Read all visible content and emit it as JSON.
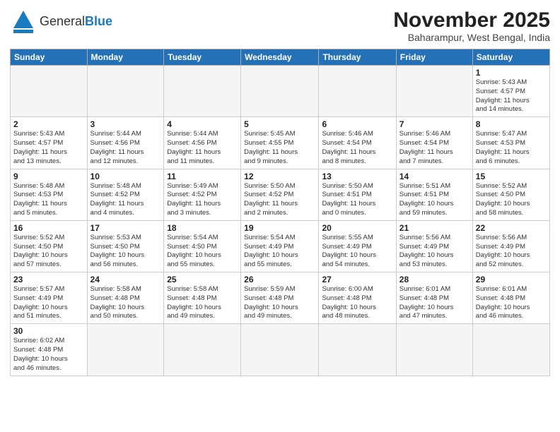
{
  "header": {
    "logo_general": "General",
    "logo_blue": "Blue",
    "month_title": "November 2025",
    "location": "Baharampur, West Bengal, India"
  },
  "weekdays": [
    "Sunday",
    "Monday",
    "Tuesday",
    "Wednesday",
    "Thursday",
    "Friday",
    "Saturday"
  ],
  "weeks": [
    [
      {
        "day": null,
        "info": null
      },
      {
        "day": null,
        "info": null
      },
      {
        "day": null,
        "info": null
      },
      {
        "day": null,
        "info": null
      },
      {
        "day": null,
        "info": null
      },
      {
        "day": null,
        "info": null
      },
      {
        "day": "1",
        "info": "Sunrise: 5:43 AM\nSunset: 4:57 PM\nDaylight: 11 hours\nand 14 minutes."
      }
    ],
    [
      {
        "day": "2",
        "info": "Sunrise: 5:43 AM\nSunset: 4:57 PM\nDaylight: 11 hours\nand 13 minutes."
      },
      {
        "day": "3",
        "info": "Sunrise: 5:44 AM\nSunset: 4:56 PM\nDaylight: 11 hours\nand 12 minutes."
      },
      {
        "day": "4",
        "info": "Sunrise: 5:44 AM\nSunset: 4:56 PM\nDaylight: 11 hours\nand 11 minutes."
      },
      {
        "day": "5",
        "info": "Sunrise: 5:45 AM\nSunset: 4:55 PM\nDaylight: 11 hours\nand 9 minutes."
      },
      {
        "day": "6",
        "info": "Sunrise: 5:46 AM\nSunset: 4:54 PM\nDaylight: 11 hours\nand 8 minutes."
      },
      {
        "day": "7",
        "info": "Sunrise: 5:46 AM\nSunset: 4:54 PM\nDaylight: 11 hours\nand 7 minutes."
      },
      {
        "day": "8",
        "info": "Sunrise: 5:47 AM\nSunset: 4:53 PM\nDaylight: 11 hours\nand 6 minutes."
      }
    ],
    [
      {
        "day": "9",
        "info": "Sunrise: 5:48 AM\nSunset: 4:53 PM\nDaylight: 11 hours\nand 5 minutes."
      },
      {
        "day": "10",
        "info": "Sunrise: 5:48 AM\nSunset: 4:52 PM\nDaylight: 11 hours\nand 4 minutes."
      },
      {
        "day": "11",
        "info": "Sunrise: 5:49 AM\nSunset: 4:52 PM\nDaylight: 11 hours\nand 3 minutes."
      },
      {
        "day": "12",
        "info": "Sunrise: 5:50 AM\nSunset: 4:52 PM\nDaylight: 11 hours\nand 2 minutes."
      },
      {
        "day": "13",
        "info": "Sunrise: 5:50 AM\nSunset: 4:51 PM\nDaylight: 11 hours\nand 0 minutes."
      },
      {
        "day": "14",
        "info": "Sunrise: 5:51 AM\nSunset: 4:51 PM\nDaylight: 10 hours\nand 59 minutes."
      },
      {
        "day": "15",
        "info": "Sunrise: 5:52 AM\nSunset: 4:50 PM\nDaylight: 10 hours\nand 58 minutes."
      }
    ],
    [
      {
        "day": "16",
        "info": "Sunrise: 5:52 AM\nSunset: 4:50 PM\nDaylight: 10 hours\nand 57 minutes."
      },
      {
        "day": "17",
        "info": "Sunrise: 5:53 AM\nSunset: 4:50 PM\nDaylight: 10 hours\nand 56 minutes."
      },
      {
        "day": "18",
        "info": "Sunrise: 5:54 AM\nSunset: 4:50 PM\nDaylight: 10 hours\nand 55 minutes."
      },
      {
        "day": "19",
        "info": "Sunrise: 5:54 AM\nSunset: 4:49 PM\nDaylight: 10 hours\nand 55 minutes."
      },
      {
        "day": "20",
        "info": "Sunrise: 5:55 AM\nSunset: 4:49 PM\nDaylight: 10 hours\nand 54 minutes."
      },
      {
        "day": "21",
        "info": "Sunrise: 5:56 AM\nSunset: 4:49 PM\nDaylight: 10 hours\nand 53 minutes."
      },
      {
        "day": "22",
        "info": "Sunrise: 5:56 AM\nSunset: 4:49 PM\nDaylight: 10 hours\nand 52 minutes."
      }
    ],
    [
      {
        "day": "23",
        "info": "Sunrise: 5:57 AM\nSunset: 4:49 PM\nDaylight: 10 hours\nand 51 minutes."
      },
      {
        "day": "24",
        "info": "Sunrise: 5:58 AM\nSunset: 4:48 PM\nDaylight: 10 hours\nand 50 minutes."
      },
      {
        "day": "25",
        "info": "Sunrise: 5:58 AM\nSunset: 4:48 PM\nDaylight: 10 hours\nand 49 minutes."
      },
      {
        "day": "26",
        "info": "Sunrise: 5:59 AM\nSunset: 4:48 PM\nDaylight: 10 hours\nand 49 minutes."
      },
      {
        "day": "27",
        "info": "Sunrise: 6:00 AM\nSunset: 4:48 PM\nDaylight: 10 hours\nand 48 minutes."
      },
      {
        "day": "28",
        "info": "Sunrise: 6:01 AM\nSunset: 4:48 PM\nDaylight: 10 hours\nand 47 minutes."
      },
      {
        "day": "29",
        "info": "Sunrise: 6:01 AM\nSunset: 4:48 PM\nDaylight: 10 hours\nand 46 minutes."
      }
    ],
    [
      {
        "day": "30",
        "info": "Sunrise: 6:02 AM\nSunset: 4:48 PM\nDaylight: 10 hours\nand 46 minutes."
      },
      {
        "day": null,
        "info": null
      },
      {
        "day": null,
        "info": null
      },
      {
        "day": null,
        "info": null
      },
      {
        "day": null,
        "info": null
      },
      {
        "day": null,
        "info": null
      },
      {
        "day": null,
        "info": null
      }
    ]
  ]
}
